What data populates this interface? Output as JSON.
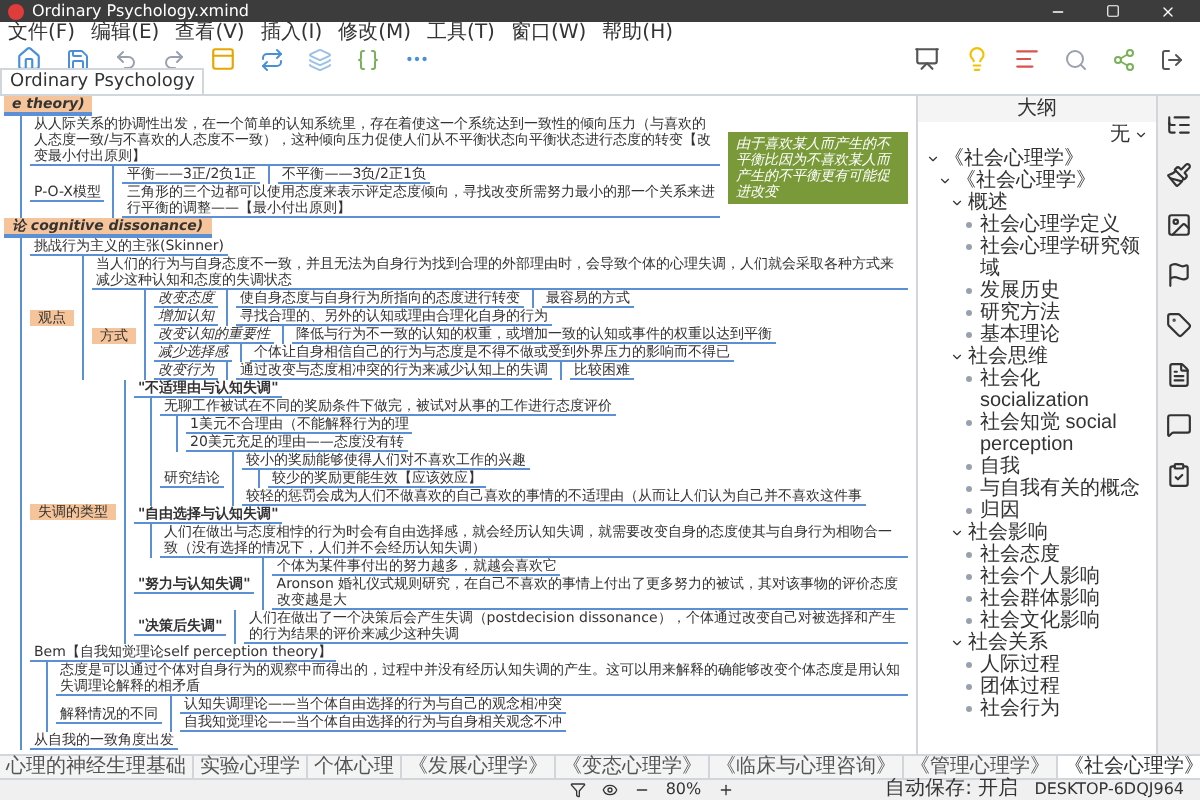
{
  "window": {
    "title": "Ordinary Psychology.xmind"
  },
  "menu": [
    "文件(F)",
    "编辑(E)",
    "查看(V)",
    "插入(I)",
    "修改(M)",
    "工具(T)",
    "窗口(W)",
    "帮助(H)"
  ],
  "document_tab": {
    "label": "Ordinary Psychology"
  },
  "canvas": {
    "maps": [
      {
        "text": "e theory)",
        "kind": "root",
        "children": [
          {
            "text": "从人际关系的协调性出发，在一个简单的认知系统里，存在着使这一个系统达到一致性的倾向压力（与喜欢的人态度一致/与不喜欢的人态度不一致），这种倾向压力促使人们从不平衡状态向平衡状态进行态度的转变【改变最小付出原则】",
            "kind": "plain"
          },
          {
            "text": "P-O-X模型",
            "kind": "plain",
            "children": [
              {
                "text": "平衡——3正/2负1正",
                "kind": "plain",
                "children": [
                  {
                    "text": "不平衡——3负/2正1负",
                    "kind": "plain"
                  }
                ]
              },
              {
                "text": "三角形的三个边都可以使用态度来表示评定态度倾向，寻找改变所需努力最小的那一个关系来进行平衡的调整——【最小付出原则】",
                "kind": "plain"
              }
            ]
          }
        ],
        "summary": "由于喜欢某人而产生的不平衡比因为不喜欢某人而产生的不平衡更有可能促进改变"
      },
      {
        "text": "论 cognitive dissonance)",
        "kind": "root",
        "children": [
          {
            "text": "挑战行为主义的主张(Skinner)",
            "kind": "plain"
          },
          {
            "text": "观点",
            "kind": "orange",
            "children": [
              {
                "text": "当人们的行为与自身态度不一致，并且无法为自身行为找到合理的外部理由时，会导致个体的心理失调，人们就会采取各种方式来减少这种认知和态度的失调状态",
                "kind": "plain"
              },
              {
                "text": "方式",
                "kind": "orange",
                "children": [
                  {
                    "text": "改变态度",
                    "kind": "italic",
                    "children": [
                      {
                        "text": "使自身态度与自身行为所指向的态度进行转变",
                        "kind": "plain",
                        "children": [
                          {
                            "text": "最容易的方式",
                            "kind": "plain"
                          }
                        ]
                      }
                    ]
                  },
                  {
                    "text": "增加认知",
                    "kind": "italic",
                    "children": [
                      {
                        "text": "寻找合理的、另外的认知或理由合理化自身的行为",
                        "kind": "plain"
                      }
                    ]
                  },
                  {
                    "text": "改变认知的重要性",
                    "kind": "italic",
                    "children": [
                      {
                        "text": "降低与行为不一致的认知的权重，或增加一致的认知或事件的权重以达到平衡",
                        "kind": "plain"
                      }
                    ]
                  },
                  {
                    "text": "减少选择感",
                    "kind": "italic",
                    "children": [
                      {
                        "text": "个体让自身相信自己的行为与态度是不得不做或受到外界压力的影响而不得已",
                        "kind": "plain"
                      }
                    ]
                  },
                  {
                    "text": "改变行为",
                    "kind": "italic",
                    "children": [
                      {
                        "text": "通过改变与态度相冲突的行为来减少认知上的失调",
                        "kind": "plain",
                        "children": [
                          {
                            "text": "比较困难",
                            "kind": "plain"
                          }
                        ]
                      }
                    ]
                  }
                ]
              }
            ]
          },
          {
            "text": "失调的类型",
            "kind": "orange",
            "children": [
              {
                "text": "\"不适理由与认知失调\"",
                "kind": "bold",
                "children": [
                  {
                    "text": "无聊工作被试在不同的奖励条件下做完，被试对从事的工作进行态度评价",
                    "kind": "plain",
                    "children": [
                      {
                        "text": "1美元不合理由（不能解释行为的理",
                        "kind": "plain"
                      },
                      {
                        "text": "20美元充足的理由——态度没有转",
                        "kind": "plain"
                      }
                    ]
                  },
                  {
                    "text": "研究结论",
                    "kind": "plain",
                    "children": [
                      {
                        "text": "较小的奖励能够使得人们对不喜欢工作的兴趣",
                        "kind": "plain",
                        "children": [
                          {
                            "text": "较少的奖励更能生效【应该效应】",
                            "kind": "plain"
                          }
                        ]
                      },
                      {
                        "text": "较轻的惩罚会成为人们不做喜欢的自己喜欢的事情的不适理由（从而让人们认为自己并不喜欢这件事",
                        "kind": "plain"
                      }
                    ]
                  }
                ]
              },
              {
                "text": "\"自由选择与认知失调\"",
                "kind": "bold",
                "children": [
                  {
                    "text": "人们在做出与态度相悖的行为时会有自由选择感，就会经历认知失调，就需要改变自身的态度使其与自身行为相吻合一致（没有选择的情况下，人们并不会经历认知失调）",
                    "kind": "plain"
                  }
                ]
              },
              {
                "text": "\"努力与认知失调\"",
                "kind": "bold",
                "children": [
                  {
                    "text": "个体为某件事付出的努力越多，就越会喜欢它",
                    "kind": "plain"
                  },
                  {
                    "text": "Aronson 婚礼仪式规则研究，在自己不喜欢的事情上付出了更多努力的被试，其对该事物的评价态度改变越是大",
                    "kind": "plain"
                  }
                ]
              },
              {
                "text": "\"决策后失调\"",
                "kind": "bold",
                "children": [
                  {
                    "text": "人们在做出了一个决策后会产生失调（postdecision dissonance），个体通过改变自己对被选择和产生的行为结果的评价来减少这种失调",
                    "kind": "plain"
                  }
                ]
              }
            ]
          },
          {
            "text": "Bem【自我知觉理论self perception theory】",
            "kind": "plain",
            "children": [
              {
                "text": "态度是可以通过个体对自身行为的观察中而得出的，过程中并没有经历认知失调的产生。这可以用来解释的确能够改变个体态度是用认知失调理论解释的相矛盾",
                "kind": "plain"
              },
              {
                "text": "解释情况的不同",
                "kind": "plain",
                "children": [
                  {
                    "text": "认知失调理论——当个体自由选择的行为与自己的观念相冲突",
                    "kind": "plain"
                  },
                  {
                    "text": "自我知觉理论——当个体自由选择的行为与自身相关观念不冲",
                    "kind": "plain"
                  }
                ]
              }
            ]
          },
          {
            "text": "从自我的一致角度出发",
            "kind": "plain"
          }
        ]
      }
    ]
  },
  "sheet_tabs": [
    {
      "label": "心理的神经生理基础",
      "selected": false
    },
    {
      "label": "实验心理学",
      "selected": false
    },
    {
      "label": "个体心理",
      "selected": false
    },
    {
      "label": "《发展心理学》",
      "selected": false
    },
    {
      "label": "《变态心理学》",
      "selected": false
    },
    {
      "label": "《临床与心理咨询》",
      "selected": false
    },
    {
      "label": "《管理心理学》",
      "selected": false
    },
    {
      "label": "《社会心理学》",
      "selected": true
    }
  ],
  "zoom": "80%",
  "outline": {
    "title": "大纲",
    "filter": "无",
    "tree": [
      {
        "text": "《社会心理学》",
        "expanded": true,
        "children": [
          {
            "text": "《社会心理学》",
            "expanded": true,
            "children": [
              {
                "text": "概述",
                "expanded": true,
                "children": [
                  {
                    "text": "社会心理学定义"
                  },
                  {
                    "text": "社会心理学研究领域"
                  },
                  {
                    "text": "发展历史"
                  },
                  {
                    "text": "研究方法"
                  },
                  {
                    "text": "基本理论"
                  }
                ]
              },
              {
                "text": "社会思维",
                "expanded": true,
                "children": [
                  {
                    "text": "社会化socialization"
                  },
                  {
                    "text": "社会知觉 social perception"
                  },
                  {
                    "text": "自我"
                  },
                  {
                    "text": "与自我有关的概念"
                  },
                  {
                    "text": "归因"
                  }
                ]
              },
              {
                "text": "社会影响",
                "expanded": true,
                "children": [
                  {
                    "text": "社会态度"
                  },
                  {
                    "text": "社会个人影响"
                  },
                  {
                    "text": "社会群体影响"
                  },
                  {
                    "text": "社会文化影响"
                  }
                ]
              },
              {
                "text": "社会关系",
                "expanded": true,
                "children": [
                  {
                    "text": "人际过程"
                  },
                  {
                    "text": "团体过程"
                  },
                  {
                    "text": "社会行为"
                  }
                ]
              }
            ]
          }
        ]
      }
    ]
  },
  "status_bar": {
    "autosave": "自动保存: 开启",
    "computer": "DESKTOP-6DQJ964"
  }
}
